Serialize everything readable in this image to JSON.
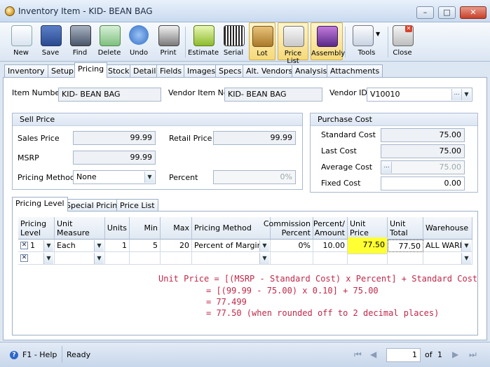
{
  "window": {
    "title": "Inventory Item - KID- BEAN BAG"
  },
  "toolbar": {
    "buttons": [
      {
        "label": "New"
      },
      {
        "label": "Save"
      },
      {
        "label": "Find"
      },
      {
        "label": "Delete"
      },
      {
        "label": "Undo"
      },
      {
        "label": "Print"
      },
      {
        "label": "Estimate"
      },
      {
        "label": "Serial"
      },
      {
        "label": "Lot"
      },
      {
        "label": "Price List"
      },
      {
        "label": "Assembly"
      },
      {
        "label": "Tools"
      },
      {
        "label": "Close"
      }
    ]
  },
  "tabs": [
    "Inventory",
    "Setup",
    "Pricing",
    "Stock",
    "Detail",
    "Fields",
    "Images",
    "Specs",
    "Alt. Vendors",
    "Analysis",
    "Attachments"
  ],
  "header": {
    "item_number_label": "Item Number",
    "item_number": "KID- BEAN BAG",
    "vendor_item_no_label": "Vendor Item No",
    "vendor_item_no": "KID- BEAN BAG",
    "vendor_id_label": "Vendor ID",
    "vendor_id": "V10010"
  },
  "sell_price": {
    "title": "Sell Price",
    "sales_price_label": "Sales Price",
    "sales_price": "99.99",
    "retail_price_label": "Retail Price",
    "retail_price": "99.99",
    "msrp_label": "MSRP",
    "msrp": "99.99",
    "pricing_method_label": "Pricing Method",
    "pricing_method": "None",
    "percent_label": "Percent",
    "percent": "0%"
  },
  "purchase_cost": {
    "title": "Purchase Cost",
    "standard_cost_label": "Standard Cost",
    "standard_cost": "75.00",
    "last_cost_label": "Last Cost",
    "last_cost": "75.00",
    "average_cost_label": "Average Cost",
    "average_cost": "75.00",
    "fixed_cost_label": "Fixed Cost",
    "fixed_cost": "0.00"
  },
  "inner_tabs": [
    "Pricing Level",
    "Special Pricing",
    "Price List"
  ],
  "grid": {
    "columns": {
      "pricing_level": "Pricing Level",
      "unit_measure": "Unit Measure",
      "units": "Units",
      "min": "Min",
      "max": "Max",
      "pricing_method": "Pricing Method",
      "commission_percent": "Commission Percent",
      "percent_amount": "Percent/ Amount",
      "unit_price": "Unit Price",
      "unit_total": "Unit Total",
      "warehouse": "Warehouse"
    },
    "row1": {
      "pricing_level": "1",
      "unit_measure": "Each",
      "units": "1",
      "min": "5",
      "max": "20",
      "pricing_method": "Percent of Margin (",
      "commission_percent": "0%",
      "percent_amount": "10.00",
      "unit_price": "77.50",
      "unit_total": "77.50",
      "warehouse": "ALL WARE"
    }
  },
  "note": {
    "line1": "Unit Price = [(MSRP - Standard Cost) x Percent] + Standard Cost",
    "line2": "= [(99.99 - 75.00) x 0.10] + 75.00",
    "line3": "= 77.499",
    "line4": "= 77.50 (when rounded off to 2 decimal places)"
  },
  "status": {
    "help": "F1 - Help",
    "state": "Ready",
    "page": "1",
    "of_label": "of",
    "total": "1"
  },
  "colors": {
    "highlight": "#ffff33",
    "note": "#c0284a"
  }
}
